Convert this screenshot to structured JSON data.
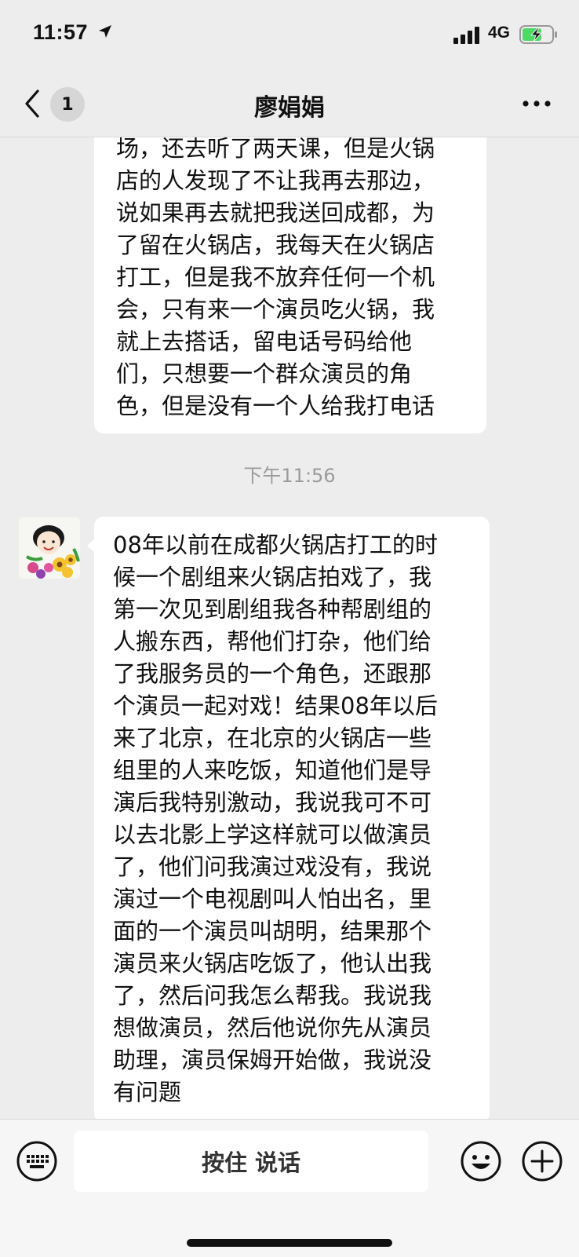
{
  "status_bar": {
    "time": "11:57",
    "network": "4G"
  },
  "nav": {
    "unread_count": "1",
    "title": "廖娟娟"
  },
  "messages": [
    {
      "lines": [
        "场，还去听了两天课，但是火锅",
        "店的人发现了不让我再去那边，",
        "说如果再去就把我送回成都，为",
        "了留在火锅店，我每天在火锅店",
        "打工，但是我不放弃任何一个机",
        "会，只有来一个演员吃火锅，我",
        "就上去搭话，留电话号码给他",
        "们，只想要一个群众演员的角",
        "色，但是没有一个人给我打电话"
      ]
    },
    {
      "lines": [
        "08年以前在成都火锅店打工的时",
        "候一个剧组来火锅店拍戏了，我",
        "第一次见到剧组我各种帮剧组的",
        "人搬东西，帮他们打杂，他们给",
        "了我服务员的一个角色，还跟那",
        "个演员一起对戏！结果08年以后",
        "来了北京，在北京的火锅店一些",
        "组里的人来吃饭，知道他们是导",
        "演后我特别激动，我说我可不可",
        "以去北影上学这样就可以做演员",
        "了，他们问我演过戏没有，我说",
        "演过一个电视剧叫人怕出名，里",
        "面的一个演员叫胡明，结果那个",
        "演员来火锅店吃饭了，他认出我",
        "了，然后问我怎么帮我。我说我",
        "想做演员，然后他说你先从演员",
        "助理，演员保姆开始做，我说没",
        "有问题"
      ]
    }
  ],
  "timestamp": "下午11:56",
  "input_bar": {
    "hold_to_talk_label": "按住 说话"
  },
  "icons": {
    "status": [
      "location-arrow-icon",
      "signal-icon",
      "battery-charging-icon"
    ],
    "nav": [
      "back-icon",
      "more-icon"
    ],
    "input": [
      "keyboard-icon",
      "emoji-icon",
      "plus-icon"
    ]
  },
  "colors": {
    "background": "#ededed",
    "bubble": "#ffffff",
    "battery_charge": "#4cd964",
    "timestamp_text": "#9b9b9b"
  }
}
